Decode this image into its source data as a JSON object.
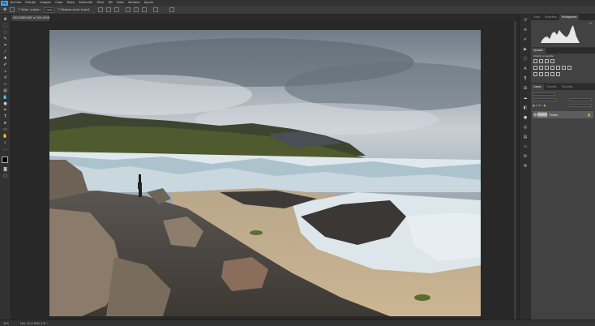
{
  "app": {
    "logo": "Ps"
  },
  "menu": [
    "Archivo",
    "Edición",
    "Imagen",
    "Capa",
    "Texto",
    "Selección",
    "Filtro",
    "3D",
    "Vista",
    "Ventana",
    "Ayuda"
  ],
  "options_bar": {
    "tool_icon": "move-tool-icon",
    "auto_select_label": "Selec. autom.:",
    "auto_select_value": "Capa",
    "transform_label": "Mostrar contr. transf."
  },
  "document_tab": {
    "title": "DSC03805.NEF al 30% (RGB/8)"
  },
  "status_bar": {
    "zoom": "30%",
    "doc_info": "Doc: 50,2 M/50,2 M"
  },
  "panels": {
    "top_tabs": [
      "Color",
      "Muestras",
      "Histograma"
    ],
    "top_active": 2,
    "adjustments": {
      "title": "Ajustes",
      "subtitle": "Añadir un ajuste"
    },
    "layers_tabs": [
      "Capas",
      "Canales",
      "Trazados"
    ],
    "layers_active": 0,
    "layer": {
      "name": "Fondo"
    }
  },
  "colors": {
    "accent": "#31a8ff",
    "panel": "#424242",
    "chrome": "#323232",
    "canvas_bg": "#282828"
  }
}
